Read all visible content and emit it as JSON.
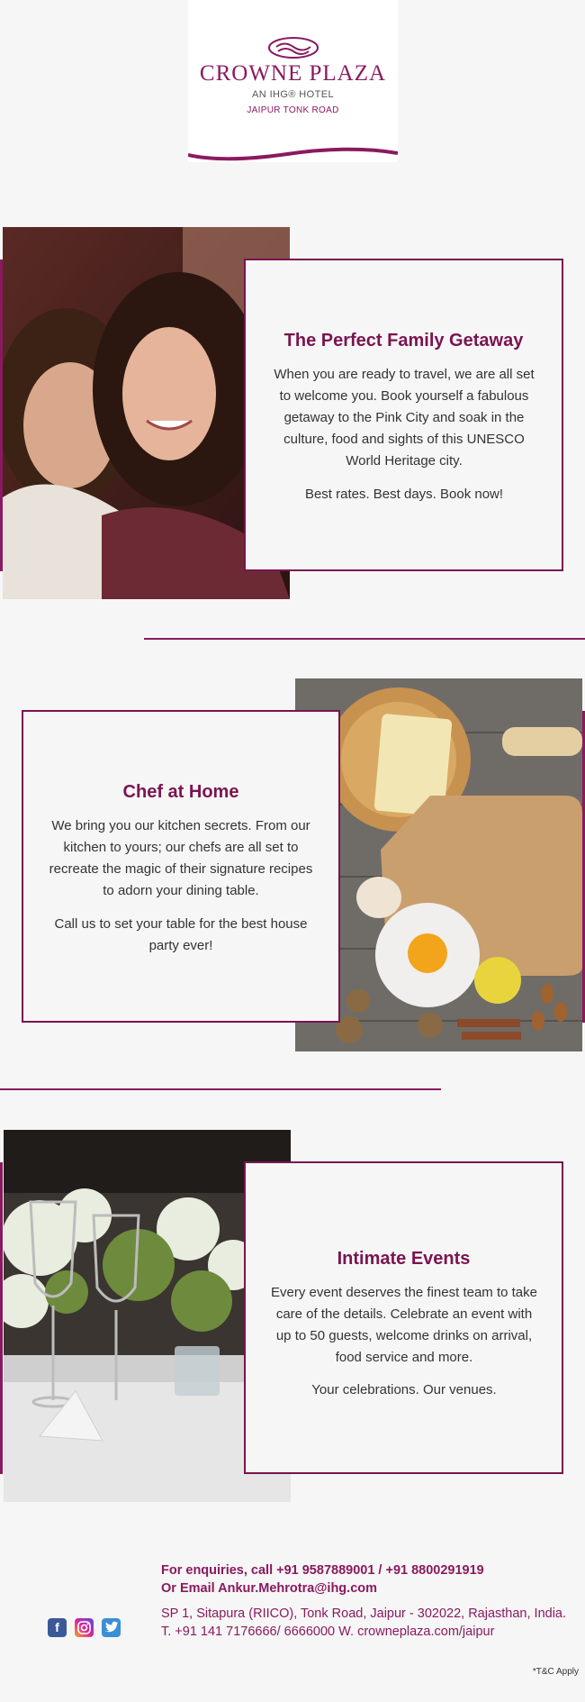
{
  "brand": {
    "name": "CROWNE PLAZA",
    "subline": "AN IHG® HOTEL",
    "location": "JAIPUR TONK ROAD",
    "color": "#8a1a5f"
  },
  "sections": [
    {
      "title": "The Perfect Family Getaway",
      "body": "When you are ready to travel, we are all set to welcome you. Book yourself a fabulous getaway to the Pink City and soak in the culture, food and sights of this UNESCO World Heritage city.",
      "tagline": "Best rates. Best days. Book now!",
      "image": "smiling-couple-photo"
    },
    {
      "title": "Chef at Home",
      "body": "We bring you our kitchen secrets. From our kitchen to yours; our chefs are all set to recreate the magic of their signature recipes to adorn your dining table.",
      "tagline": "Call us to set your table for the best house party ever!",
      "image": "kitchen-ingredients-photo"
    },
    {
      "title": "Intimate Events",
      "body": "Every event deserves the finest team to take care of the details. Celebrate an event with up to 50 guests, welcome drinks on arrival, food service and more.",
      "tagline": "Your celebrations. Our venues.",
      "image": "table-setting-photo"
    }
  ],
  "footer": {
    "enquiry": "For enquiries, call +91 9587889001 / +91 8800291919",
    "email": "Or Email Ankur.Mehrotra@ihg.com",
    "address": "SP 1, Sitapura (RIICO), Tonk Road, Jaipur - 302022, Rajasthan, India.",
    "contact": "T. +91 141 7176666/ 6666000 W. crowneplaza.com/jaipur",
    "social": [
      "facebook-icon",
      "instagram-icon",
      "twitter-icon"
    ],
    "terms": "*T&C Apply"
  }
}
